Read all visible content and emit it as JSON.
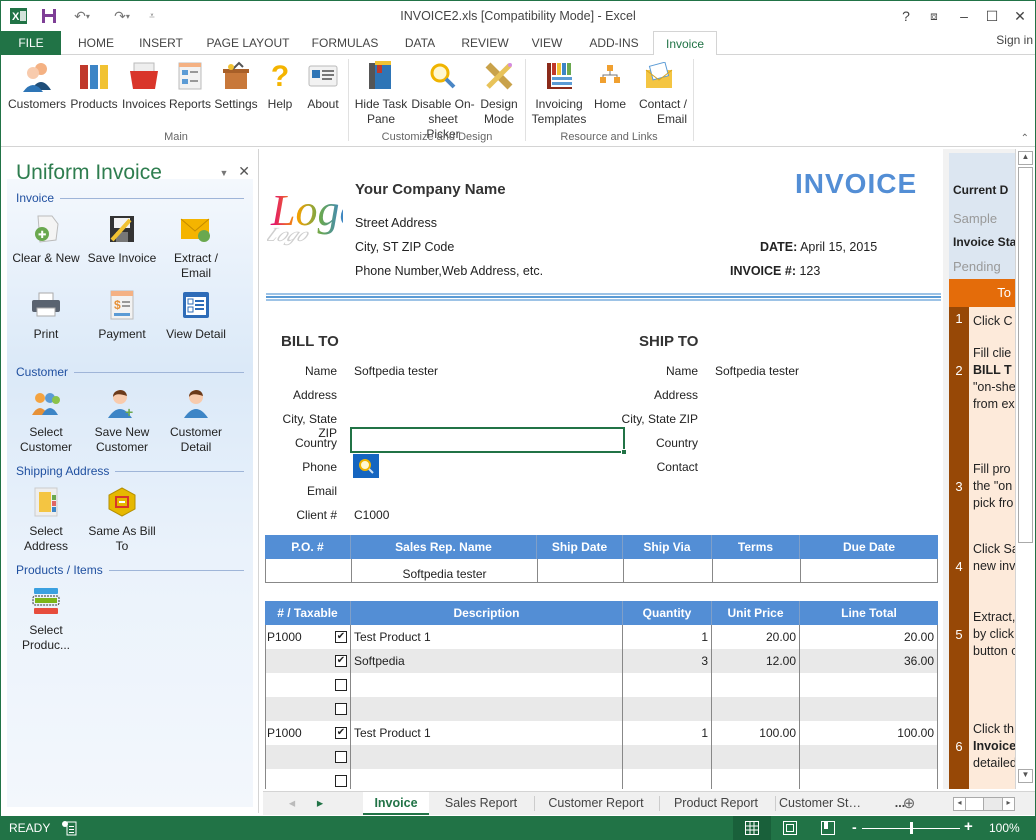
{
  "window": {
    "title": "INVOICE2.xls  [Compatibility Mode] - Excel",
    "controls": [
      "?",
      "restore-ribbon",
      "minimize",
      "maximize",
      "close"
    ],
    "sign_in": "Sign in"
  },
  "quick_access": {
    "app_icon": "excel-icon",
    "save": "save-icon",
    "undo": "undo-icon",
    "redo": "redo-icon",
    "customize": "customize-icon"
  },
  "ribbon_tabs": [
    {
      "label": "FILE"
    },
    {
      "label": "HOME"
    },
    {
      "label": "INSERT"
    },
    {
      "label": "PAGE LAYOUT"
    },
    {
      "label": "FORMULAS"
    },
    {
      "label": "DATA"
    },
    {
      "label": "REVIEW"
    },
    {
      "label": "VIEW"
    },
    {
      "label": "ADD-INS"
    },
    {
      "label": "Invoice",
      "active": true
    }
  ],
  "ribbon": {
    "groups": [
      {
        "label": "Main",
        "buttons": [
          {
            "label": "Customers",
            "icon": "customers-icon"
          },
          {
            "label": "Products",
            "icon": "products-icon"
          },
          {
            "label": "Invoices",
            "icon": "invoices-icon"
          },
          {
            "label": "Reports",
            "icon": "reports-icon"
          },
          {
            "label": "Settings",
            "icon": "settings-icon"
          },
          {
            "label": "Help",
            "icon": "help-icon"
          },
          {
            "label": "About",
            "icon": "about-icon"
          }
        ]
      },
      {
        "label": "Customize and Design",
        "buttons": [
          {
            "label": "Hide Task",
            "label2": "Pane",
            "icon": "hide-task-pane-icon"
          },
          {
            "label": "Disable On-",
            "label2": "sheet Picker",
            "icon": "magnifier-icon"
          },
          {
            "label": "Design",
            "label2": "Mode",
            "icon": "design-mode-icon"
          }
        ]
      },
      {
        "label": "Resource and Links",
        "buttons": [
          {
            "label": "Invoicing",
            "label2": "Templates",
            "icon": "templates-icon"
          },
          {
            "label": "Home",
            "icon": "home-icon"
          },
          {
            "label": "Contact /",
            "label2": "Email",
            "icon": "contact-email-icon"
          }
        ]
      }
    ]
  },
  "task_pane": {
    "title": "Uniform Invoice",
    "sections": [
      {
        "label": "Invoice",
        "buttons": [
          {
            "label": "Clear & New"
          },
          {
            "label": "Save Invoice"
          },
          {
            "label": "Extract /",
            "label2": "Email"
          },
          {
            "label": "Print"
          },
          {
            "label": "Payment"
          },
          {
            "label": "View Detail"
          }
        ]
      },
      {
        "label": "Customer",
        "buttons": [
          {
            "label": "Select",
            "label2": "Customer"
          },
          {
            "label": "Save New",
            "label2": "Customer"
          },
          {
            "label": "Customer",
            "label2": "Detail"
          }
        ]
      },
      {
        "label": "Shipping Address",
        "buttons": [
          {
            "label": "Select",
            "label2": "Address"
          },
          {
            "label": "Same As Bill",
            "label2": "To"
          }
        ]
      },
      {
        "label": "Products / Items",
        "buttons": [
          {
            "label": "Select",
            "label2": "Produc..."
          }
        ]
      }
    ]
  },
  "invoice": {
    "logo_text": "Logo",
    "company_name": "Your Company Name",
    "street": "Street Address",
    "city": "City, ST  ZIP Code",
    "phone": "Phone Number,Web Address, etc.",
    "title": "INVOICE",
    "date_label": "DATE:",
    "date_value": "April 15, 2015",
    "number_label": "INVOICE #:",
    "number_value": "123",
    "accent_color": "#538ed5",
    "bill_to": {
      "heading": "BILL TO",
      "fields": [
        {
          "label": "Name",
          "value": "Softpedia tester"
        },
        {
          "label": "Address",
          "value": ""
        },
        {
          "label": "City, State ZIP",
          "value": ""
        },
        {
          "label": "Country",
          "value": ""
        },
        {
          "label": "Phone",
          "value": ""
        },
        {
          "label": "Email",
          "value": ""
        },
        {
          "label": "Client #",
          "value": "C1000"
        }
      ]
    },
    "ship_to": {
      "heading": "SHIP TO",
      "fields": [
        {
          "label": "Name",
          "value": "Softpedia tester"
        },
        {
          "label": "Address",
          "value": ""
        },
        {
          "label": "City, State ZIP",
          "value": ""
        },
        {
          "label": "Country",
          "value": ""
        },
        {
          "label": "Contact",
          "value": ""
        }
      ]
    },
    "order_table": {
      "headers": [
        "P.O. #",
        "Sales Rep. Name",
        "Ship Date",
        "Ship Via",
        "Terms",
        "Due Date"
      ],
      "row": [
        "",
        "Softpedia tester",
        "",
        "",
        "",
        ""
      ]
    },
    "items_table": {
      "headers": [
        "# / Taxable",
        "Description",
        "Quantity",
        "Unit Price",
        "Line Total"
      ],
      "rows": [
        {
          "num": "P1000",
          "taxable": true,
          "desc": "Test Product 1",
          "qty": "1",
          "price": "20.00",
          "total": "20.00"
        },
        {
          "num": "",
          "taxable": true,
          "desc": "Softpedia",
          "qty": "3",
          "price": "12.00",
          "total": "36.00"
        },
        {
          "num": "",
          "taxable": false,
          "desc": "",
          "qty": "",
          "price": "",
          "total": ""
        },
        {
          "num": "",
          "taxable": false,
          "desc": "",
          "qty": "",
          "price": "",
          "total": ""
        },
        {
          "num": "P1000",
          "taxable": true,
          "desc": "Test Product 1",
          "qty": "1",
          "price": "100.00",
          "total": "100.00"
        },
        {
          "num": "",
          "taxable": false,
          "desc": "",
          "qty": "",
          "price": "",
          "total": ""
        },
        {
          "num": "",
          "taxable": false,
          "desc": "",
          "qty": "",
          "price": "",
          "total": ""
        }
      ]
    }
  },
  "side_panel": {
    "current_label": "Current D",
    "current_value": "Sample",
    "status_label": "Invoice Sta",
    "status_value": "Pending",
    "todo_header": "To",
    "steps": [
      {
        "n": "1",
        "text": "Click C"
      },
      {
        "n": "2",
        "text": "Fill clie",
        "bold": "BILL T",
        "text2": "\"on-she",
        "text3": "from ex"
      },
      {
        "n": "3",
        "text": "Fill pro",
        "text2": "the \"on",
        "text3": "pick fro"
      },
      {
        "n": "4",
        "text": "Click Sa",
        "text2": "new inv"
      },
      {
        "n": "5",
        "text": "Extract,",
        "text2": "by click",
        "text3": "button c"
      },
      {
        "n": "6",
        "text": "Click th",
        "bold": "Invoice",
        "text3": "detailed"
      }
    ]
  },
  "sheet_tabs": [
    {
      "label": "Invoice",
      "active": true
    },
    {
      "label": "Sales Report"
    },
    {
      "label": "Customer Report"
    },
    {
      "label": "Product Report"
    },
    {
      "label": "Customer St…"
    }
  ],
  "sheet_tabs_more": "...",
  "status_bar": {
    "mode": "READY",
    "zoom": "100%",
    "zoom_minus": "-",
    "zoom_plus": "+"
  }
}
